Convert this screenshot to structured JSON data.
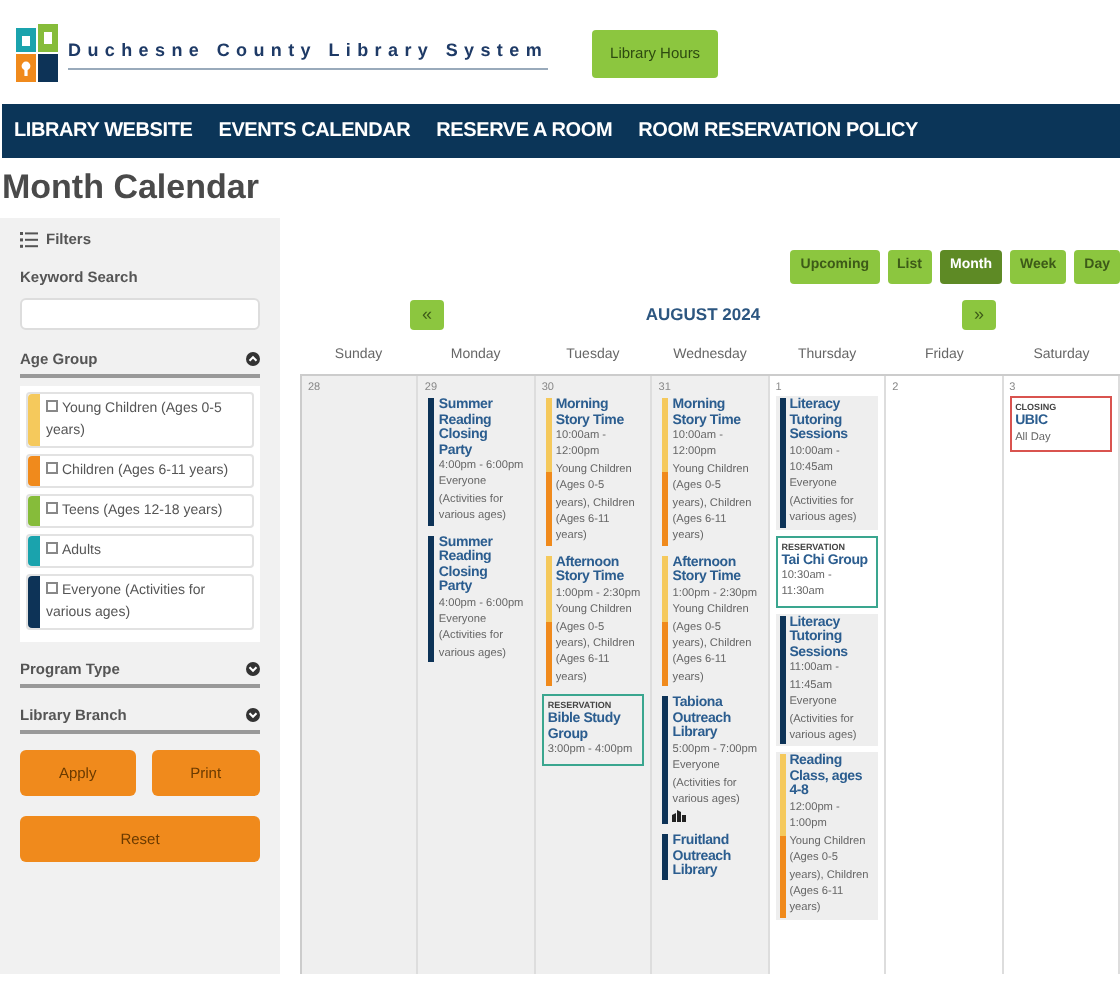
{
  "logo": {
    "text": "Duchesne County Library System"
  },
  "hours_button": "Library Hours",
  "nav": [
    "LIBRARY WEBSITE",
    "EVENTS CALENDAR",
    "RESERVE A ROOM",
    "ROOM RESERVATION POLICY"
  ],
  "page_title": "Month Calendar",
  "filters": {
    "title": "Filters",
    "keyword_label": "Keyword Search",
    "sections": [
      {
        "label": "Age Group",
        "expanded": true,
        "options": [
          {
            "label": "Young Children (Ages 0-5 years)",
            "color": "#f5c95c",
            "checked": false
          },
          {
            "label": "Children (Ages 6-11 years)",
            "color": "#f08a1c",
            "checked": false
          },
          {
            "label": "Teens (Ages 12-18 years)",
            "color": "#86bc3a",
            "checked": false
          },
          {
            "label": "Adults",
            "color": "#1aa3ad",
            "checked": false
          },
          {
            "label": "Everyone (Activities for various ages)",
            "color": "#0d3357",
            "checked": false
          }
        ]
      },
      {
        "label": "Program Type",
        "expanded": false
      },
      {
        "label": "Library Branch",
        "expanded": false
      }
    ],
    "buttons": [
      "Apply",
      "Print",
      "Reset"
    ]
  },
  "calendar": {
    "views": [
      {
        "label": "Upcoming",
        "selected": false
      },
      {
        "label": "List",
        "selected": false
      },
      {
        "label": "Month",
        "selected": true
      },
      {
        "label": "Week",
        "selected": false
      },
      {
        "label": "Day",
        "selected": false
      }
    ],
    "prev": "«",
    "next": "»",
    "month": "AUGUST 2024",
    "weekdays": [
      "Sunday",
      "Monday",
      "Tuesday",
      "Wednesday",
      "Thursday",
      "Friday",
      "Saturday"
    ],
    "days": [
      {
        "date": "28",
        "current_month": false
      },
      {
        "date": "29",
        "current_month": false,
        "events": [
          {
            "kind": "event",
            "title": "Summer Reading Closing Party",
            "time": "4:00pm - 6:00pm",
            "audience": "Everyone (Activities for various ages)",
            "bars": [
              {
                "color": "#0d3357"
              }
            ]
          },
          {
            "kind": "event",
            "title": "Summer Reading Closing Party",
            "time": "4:00pm - 6:00pm",
            "audience": "Everyone (Activities for various ages)",
            "bars": [
              {
                "color": "#0d3357"
              }
            ]
          }
        ]
      },
      {
        "date": "30",
        "current_month": false,
        "events": [
          {
            "kind": "event",
            "title": "Morning Story Time",
            "time": "10:00am - 12:00pm",
            "audience": "Young Children (Ages 0-5 years), Children (Ages 6-11 years)",
            "bars": [
              {
                "color": "#f5c95c"
              },
              {
                "color": "#f08a1c"
              }
            ]
          },
          {
            "kind": "event",
            "title": "Afternoon Story Time",
            "time": "1:00pm - 2:30pm",
            "audience": "Young Children (Ages 0-5 years), Children (Ages 6-11 years)",
            "bars": [
              {
                "color": "#f5c95c"
              },
              {
                "color": "#f08a1c"
              }
            ]
          },
          {
            "kind": "reservation",
            "label": "RESERVATION",
            "title": "Bible Study Group",
            "time": "3:00pm - 4:00pm"
          }
        ]
      },
      {
        "date": "31",
        "current_month": false,
        "events": [
          {
            "kind": "event",
            "title": "Morning Story Time",
            "time": "10:00am - 12:00pm",
            "audience": "Young Children (Ages 0-5 years), Children (Ages 6-11 years)",
            "bars": [
              {
                "color": "#f5c95c"
              },
              {
                "color": "#f08a1c"
              }
            ]
          },
          {
            "kind": "event",
            "title": "Afternoon Story Time",
            "time": "1:00pm - 2:30pm",
            "audience": "Young Children (Ages 0-5 years), Children (Ages 6-11 years)",
            "bars": [
              {
                "color": "#f5c95c"
              },
              {
                "color": "#f08a1c"
              }
            ]
          },
          {
            "kind": "event",
            "title": "Tabiona Outreach Library",
            "time": "5:00pm - 7:00pm",
            "audience": "Everyone (Activities for various ages)",
            "bars": [
              {
                "color": "#0d3357"
              }
            ],
            "with_icon": true
          },
          {
            "kind": "event",
            "title": "Fruitland Outreach Library",
            "bars": [
              {
                "color": "#0d3357"
              }
            ]
          }
        ]
      },
      {
        "date": "1",
        "current_month": true,
        "events": [
          {
            "kind": "event",
            "title": "Literacy Tutoring Sessions",
            "time": "10:00am - 10:45am",
            "audience": "Everyone (Activities for various ages)",
            "bars": [
              {
                "color": "#0d3357"
              }
            ]
          },
          {
            "kind": "reservation",
            "label": "RESERVATION",
            "title": "Tai Chi Group",
            "time": "10:30am - 11:30am"
          },
          {
            "kind": "event",
            "title": "Literacy Tutoring Sessions",
            "time": "11:00am - 11:45am",
            "audience": "Everyone (Activities for various ages)",
            "bars": [
              {
                "color": "#0d3357"
              }
            ]
          },
          {
            "kind": "event",
            "title": "Reading Class, ages 4-8",
            "time": "12:00pm - 1:00pm",
            "audience": "Young Children (Ages 0-5 years), Children (Ages 6-11 years)",
            "bars": [
              {
                "color": "#f5c95c"
              },
              {
                "color": "#f08a1c"
              }
            ]
          }
        ]
      },
      {
        "date": "2",
        "current_month": true
      },
      {
        "date": "3",
        "current_month": true,
        "events": [
          {
            "kind": "closing",
            "label": "CLOSING",
            "title": "UBIC",
            "time": "All Day"
          }
        ]
      }
    ]
  }
}
